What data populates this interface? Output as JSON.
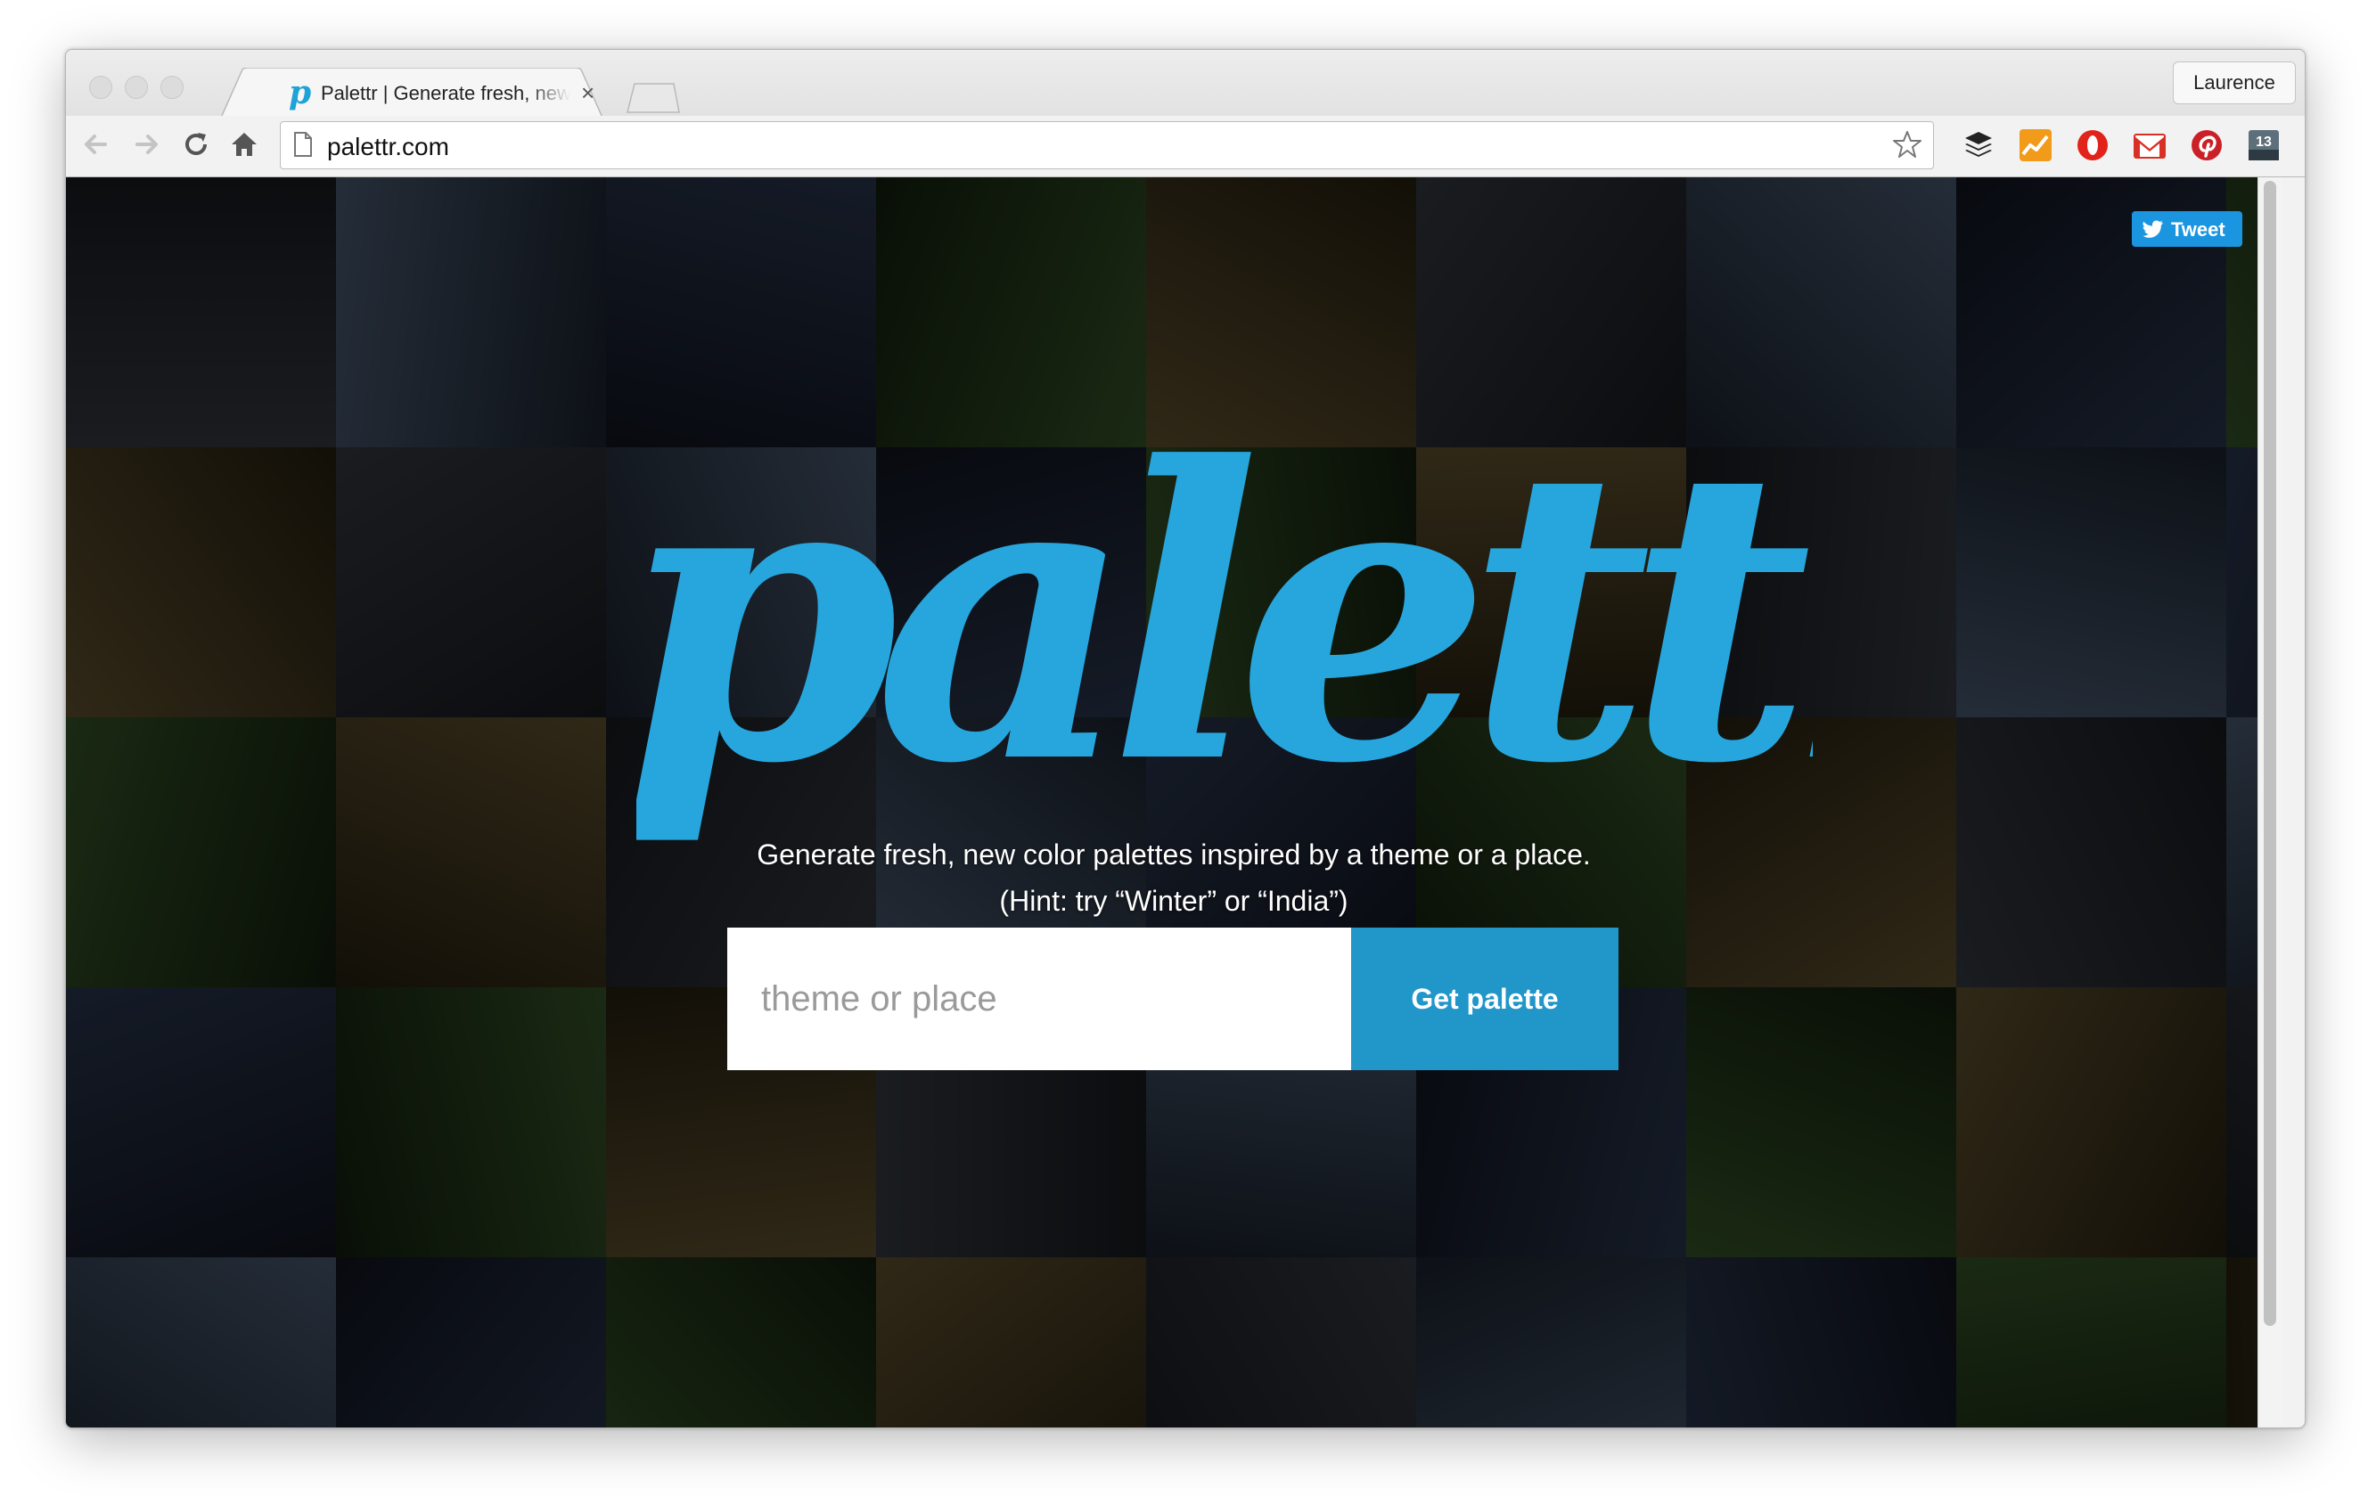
{
  "browser": {
    "tab": {
      "title": "Palettr | Generate fresh, new color palettes",
      "favicon": "palettr-favicon-icon"
    },
    "profile_name": "Laurence",
    "url": "palettr.com",
    "extensions": [
      "buffer-icon",
      "analytics-icon",
      "opera-icon",
      "gmail-icon",
      "pinterest-icon",
      "calendar-icon",
      "menu-icon"
    ],
    "calendar_day": "13"
  },
  "page": {
    "tweet_label": "Tweet",
    "logo_text": "palettr",
    "tagline_line1": "Generate fresh, new color palettes inspired by a theme or a place.",
    "tagline_line2": "(Hint: try “Winter” or “India”)",
    "search_placeholder": "theme or place",
    "search_value": "",
    "submit_label": "Get palette"
  },
  "colors": {
    "brand": "#2196c9",
    "logo": "#27a6de",
    "tweet": "#1b95e0"
  }
}
